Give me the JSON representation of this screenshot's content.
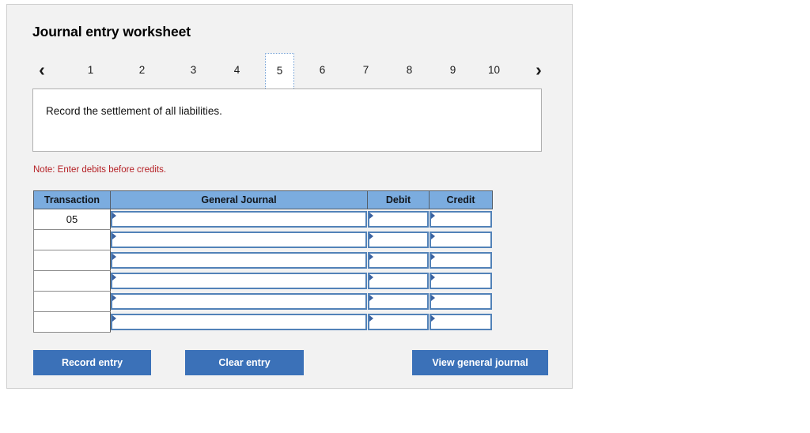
{
  "panel": {
    "title": "Journal entry worksheet"
  },
  "tabs": {
    "prev_icon": "chevron-left-icon",
    "next_icon": "chevron-right-icon",
    "prev_label": "‹",
    "next_label": "›",
    "items": [
      {
        "label": "1",
        "selected": false
      },
      {
        "label": "2",
        "selected": false
      },
      {
        "label": "3",
        "selected": false
      },
      {
        "label": "4",
        "selected": false
      },
      {
        "label": "5",
        "selected": true
      },
      {
        "label": "6",
        "selected": false
      },
      {
        "label": "7",
        "selected": false
      },
      {
        "label": "8",
        "selected": false
      },
      {
        "label": "9",
        "selected": false
      },
      {
        "label": "10",
        "selected": false
      }
    ],
    "selected_index": 4
  },
  "description": {
    "text": "Record the settlement of all liabilities."
  },
  "note": {
    "text": "Note: Enter debits before credits.",
    "color": "#b52025"
  },
  "table": {
    "headers": [
      "Transaction",
      "General Journal",
      "Debit",
      "Credit"
    ],
    "header_bg": "#7bacdf",
    "rows": [
      {
        "transaction": "05",
        "general_journal": "",
        "debit": "",
        "credit": ""
      },
      {
        "transaction": "",
        "general_journal": "",
        "debit": "",
        "credit": ""
      },
      {
        "transaction": "",
        "general_journal": "",
        "debit": "",
        "credit": ""
      },
      {
        "transaction": "",
        "general_journal": "",
        "debit": "",
        "credit": ""
      },
      {
        "transaction": "",
        "general_journal": "",
        "debit": "",
        "credit": ""
      },
      {
        "transaction": "",
        "general_journal": "",
        "debit": "",
        "credit": ""
      }
    ]
  },
  "buttons": {
    "record": "Record entry",
    "clear": "Clear entry",
    "view": "View general journal",
    "bg": "#3b71b8"
  }
}
